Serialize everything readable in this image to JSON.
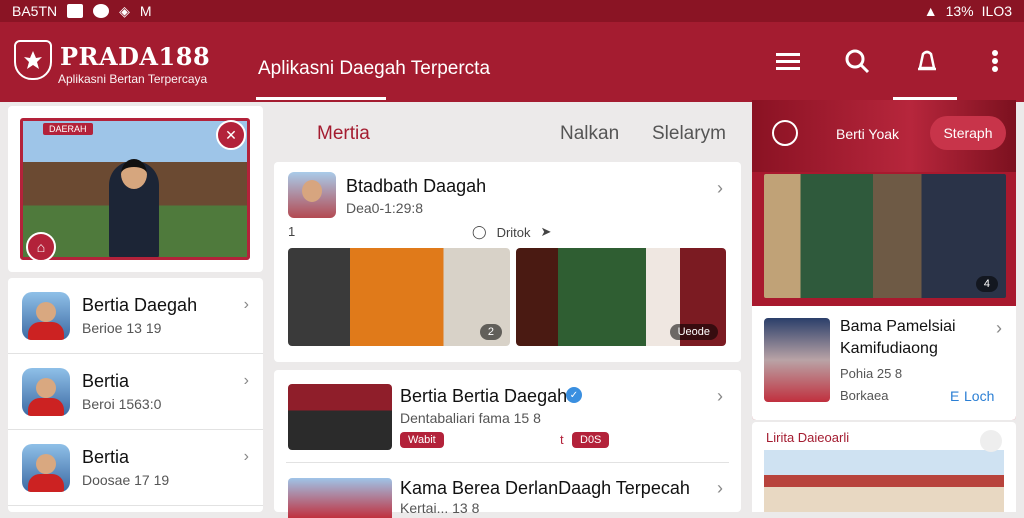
{
  "status_bar": {
    "left": "BA5TN",
    "right": "13%",
    "right2": "ILO3"
  },
  "appbar": {
    "brand": "PRADA188",
    "brand_sub": "Aplikasni Bertan Terpercaya",
    "tagline": "Aplikasni Daegah Terpercta",
    "icons": [
      "menu-icon",
      "search-icon",
      "bell-icon",
      "more-icon"
    ]
  },
  "featured": {
    "banner": "DAERAH"
  },
  "left_list": [
    {
      "title": "Bertia Daegah",
      "subtitle": "Berioe 13 19"
    },
    {
      "title": "Bertia",
      "subtitle": "Beroi 1563:0"
    },
    {
      "title": "Bertia",
      "subtitle": "Doosae 17 19"
    }
  ],
  "tabs": [
    {
      "label": "Mertia",
      "active": true
    },
    {
      "label": "Nalkan",
      "active": false
    },
    {
      "label": "Slelarym",
      "active": false
    }
  ],
  "card1": {
    "title": "Btadbath Daagah",
    "subtitle": "Dea0-1:29:8",
    "count": "1",
    "action": "Dritok",
    "photo1_badge": "2",
    "photo2_badge": "Ueode"
  },
  "card2": {
    "title": "Bertia Bertia Daegah",
    "subtitle": "Dentabaliari fama 15 8",
    "tag1": "Wabit",
    "tag2": "D0S",
    "tag2_prefix": "t",
    "title2": "Kama Berea DerlanDaagh Terpecah",
    "subtitle2": "Kertai... 13 8"
  },
  "right": {
    "chip": "Berti Yoak",
    "button": "Steraph",
    "photo_badge": "4",
    "card_title1": "Bama Pamelsiai",
    "card_title2": "Kamifudiaong",
    "card_sub": "Pohia 25 8",
    "card_sub2": "Borkaea",
    "link": "Loch",
    "link_prefix": "E",
    "bottom_title": "Lirita Daieoarli"
  },
  "colors": {
    "primary": "#a41c30",
    "accent": "#b3223a",
    "link": "#2b7fd4"
  }
}
